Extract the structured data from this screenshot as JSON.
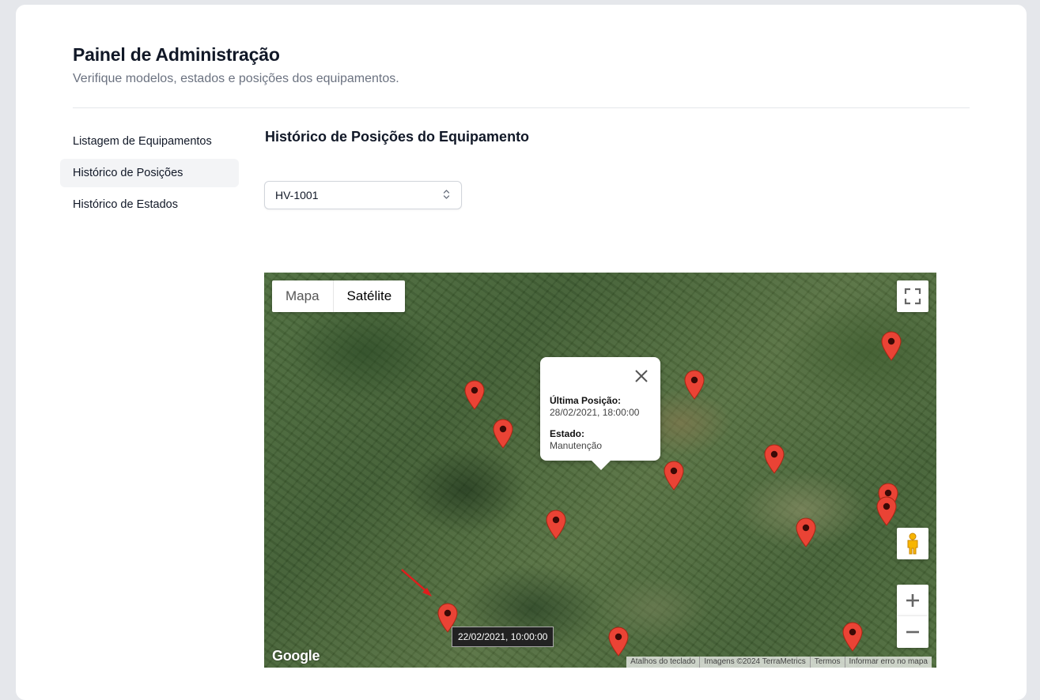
{
  "header": {
    "title": "Painel de Administração",
    "subtitle": "Verifique modelos, estados e posições dos equipamentos."
  },
  "sidebar": {
    "items": [
      {
        "label": "Listagem de Equipamentos"
      },
      {
        "label": "Histórico de Posições",
        "active": true
      },
      {
        "label": "Histórico de Estados"
      }
    ]
  },
  "main": {
    "section_title": "Histórico de Posições do Equipamento",
    "equipment_select": {
      "value": "HV-1001"
    }
  },
  "map": {
    "type_buttons": {
      "map": "Mapa",
      "satellite": "Satélite",
      "selected": "Satélite"
    },
    "infowindow": {
      "last_position_label": "Última Posição:",
      "last_position_value": "28/02/2021, 18:00:00",
      "state_label": "Estado:",
      "state_value": "Manutenção"
    },
    "tooltip": "22/02/2021, 10:00:00",
    "logo": "Google",
    "footer": {
      "shortcuts": "Atalhos do teclado",
      "imagery": "Imagens ©2024 TerraMetrics",
      "terms": "Termos",
      "report": "Informar erro no mapa"
    },
    "marker_color": "#ea4335",
    "icons": [
      "fullscreen-icon",
      "pegman-icon",
      "zoom-in-icon",
      "zoom-out-icon",
      "close-icon",
      "map-marker-icon"
    ]
  }
}
